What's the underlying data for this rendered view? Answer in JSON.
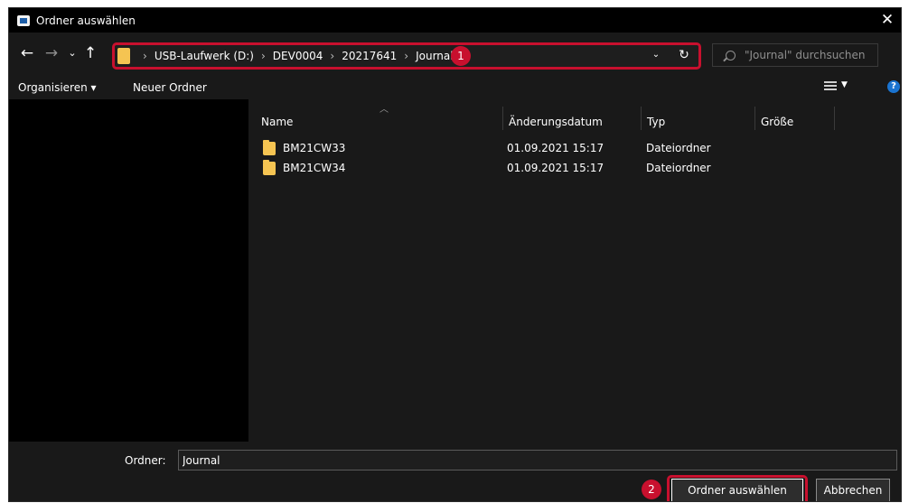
{
  "window": {
    "title": "Ordner auswählen",
    "close_glyph": "✕"
  },
  "nav": {
    "back_glyph": "←",
    "forward_glyph": "→",
    "recent_glyph": "⌄",
    "up_glyph": "↑",
    "breadcrumbs": [
      "USB-Laufwerk (D:)",
      "DEV0004",
      "20217641",
      "Journal"
    ],
    "separator": "›",
    "dropdown_glyph": "⌄",
    "refresh_glyph": "↻"
  },
  "search": {
    "placeholder": "\"Journal\" durchsuchen"
  },
  "toolbar": {
    "organize_label": "Organisieren ▾",
    "new_folder_label": "Neuer Ordner",
    "help_glyph": "?"
  },
  "columns": {
    "name": "Name",
    "modified": "Änderungsdatum",
    "type": "Typ",
    "size": "Größe"
  },
  "files": [
    {
      "name": "BM21CW33",
      "modified": "01.09.2021 15:17",
      "type": "Dateiordner",
      "size": ""
    },
    {
      "name": "BM21CW34",
      "modified": "01.09.2021 15:17",
      "type": "Dateiordner",
      "size": ""
    }
  ],
  "annotations": {
    "badge1": "1",
    "badge2": "2"
  },
  "footer": {
    "folder_label": "Ordner:",
    "folder_value": "Journal",
    "select_button": "Ordner auswählen",
    "cancel_button": "Abbrechen"
  },
  "colors": {
    "highlight": "#c8102e",
    "folder": "#f5c452",
    "background": "#191919"
  },
  "icons": [
    "app-icon",
    "close-icon",
    "back-arrow-icon",
    "forward-arrow-icon",
    "recent-locations-icon",
    "up-arrow-icon",
    "folder-icon",
    "dropdown-icon",
    "refresh-icon",
    "search-icon",
    "view-options-icon",
    "help-icon"
  ]
}
